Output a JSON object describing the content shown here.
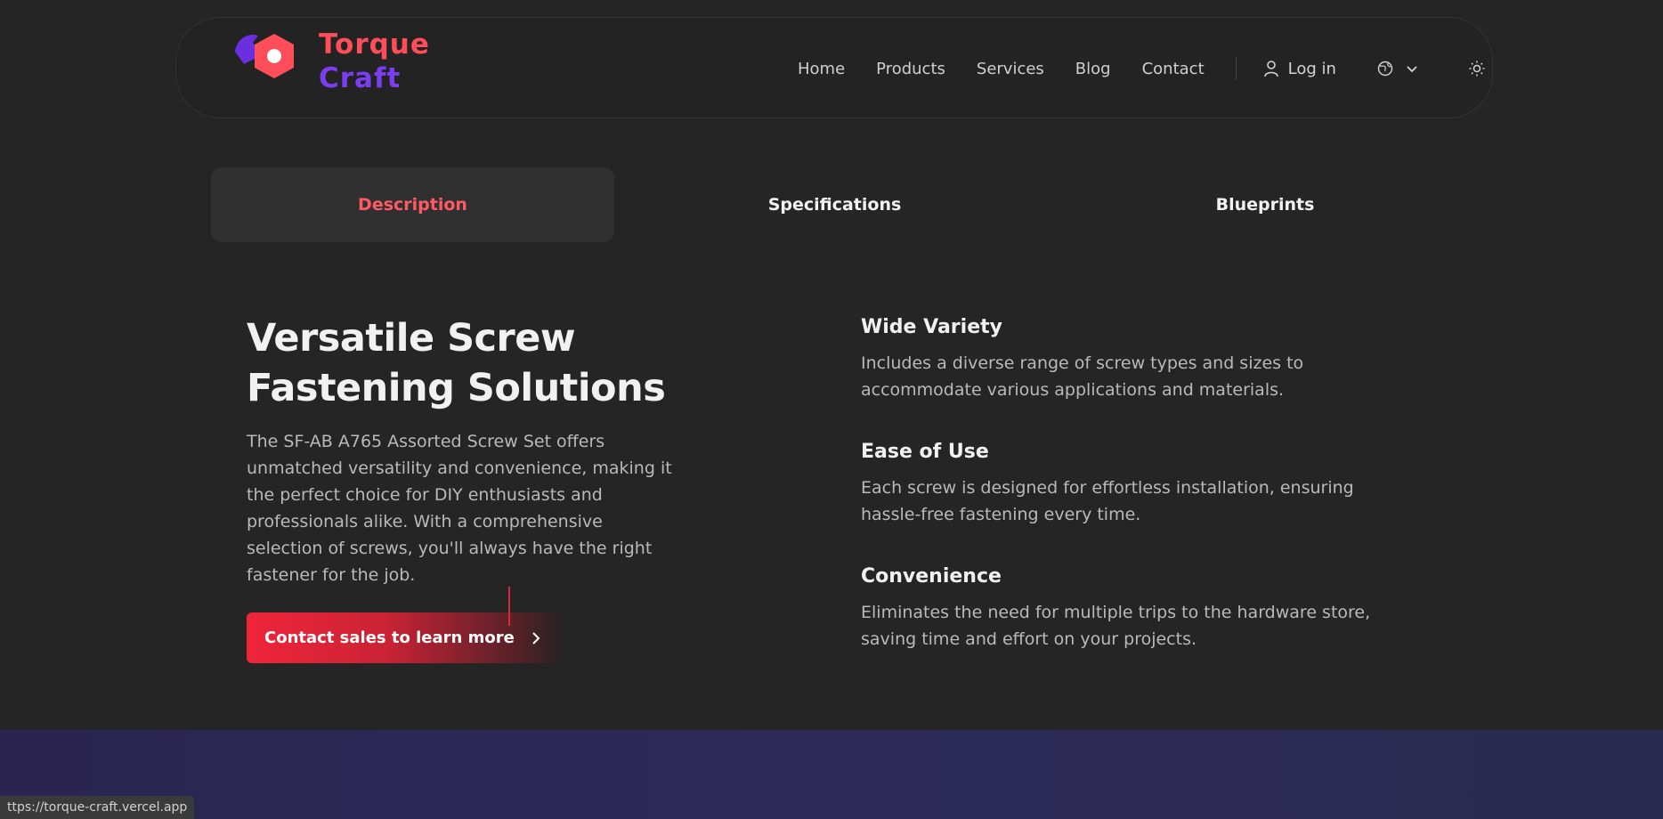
{
  "brand": {
    "line1": "Torque",
    "line2": "Craft",
    "primary_color": "#ff4d5a",
    "secondary_color": "#7a3df0"
  },
  "nav": {
    "items": [
      "Home",
      "Products",
      "Services",
      "Blog",
      "Contact"
    ],
    "login_label": "Log in",
    "icons": {
      "login": "user-icon",
      "language": "globe-icon",
      "theme": "sun-icon"
    }
  },
  "tabs": {
    "items": [
      "Description",
      "Specifications",
      "Blueprints"
    ],
    "active": "Description",
    "active_color": "#ff5a63"
  },
  "hero": {
    "headline_line1": "Versatile Screw",
    "headline_line2": "Fastening Solutions",
    "description": "The SF-AB A765 Assorted Screw Set offers unmatched versatility and convenience, making it the perfect choice for DIY enthusiasts and professionals alike. With a comprehensive selection of screws, you'll always have the right fastener for the job.",
    "cta_label": "Contact sales to learn more"
  },
  "features": [
    {
      "title": "Wide Variety",
      "text": "Includes a diverse range of screw types and sizes to accommodate various applications and materials."
    },
    {
      "title": "Ease of Use",
      "text": "Each screw is designed for effortless installation, ensuring hassle-free fastening every time."
    },
    {
      "title": "Convenience",
      "text": "Eliminates the need for multiple trips to the hardware store, saving time and effort on your projects."
    }
  ],
  "status_url": "ttps://torque-craft.vercel.app"
}
